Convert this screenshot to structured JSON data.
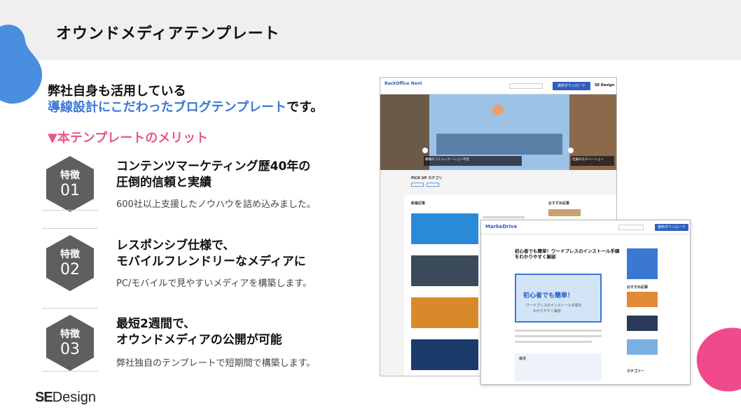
{
  "header": {
    "title": "オウンドメディアテンプレート"
  },
  "lead": {
    "line1": "弊社自身も活用している",
    "line2_highlight": "導線設計にこだわったブログテンプレート",
    "line2_suffix": "です。"
  },
  "merit_heading": "▼本テンプレートのメリット",
  "features": [
    {
      "badge_top": "特徴",
      "badge_num": "01",
      "title_l1": "コンテンツマーケティング歴40年の",
      "title_l2": "圧倒的信頼と実績",
      "desc": "600社以上支援したノウハウを詰め込みました。"
    },
    {
      "badge_top": "特徴",
      "badge_num": "02",
      "title_l1": "レスポンシブ仕様で、",
      "title_l2": "モバイルフレンドリーなメディアに",
      "desc": "PC/モバイルで見やすいメディアを構築します。"
    },
    {
      "badge_top": "特徴",
      "badge_num": "03",
      "title_l1": "最短2週間で、",
      "title_l2": "オウンドメディアの公開が可能",
      "desc": "弊社独自のテンプレートで短期間で構築します。"
    }
  ],
  "logo": {
    "bold": "SE",
    "light": "Design"
  },
  "screenshot1": {
    "site_name": "BackOffice Next",
    "button": "資料ダウンロード",
    "brand": "SE Design",
    "pickup": "PICK UP カテゴリ",
    "new_articles": "新着記事",
    "recommended": "おすすめ記事",
    "hero_caption1": "職場のコミュニケーション不足",
    "hero_caption2": "社員のモチベーション"
  },
  "screenshot2": {
    "site_name": "MarkeDrive",
    "button": "資料ダウンロード",
    "article_title": "初心者でも簡単！ワードプレスのインストール手順をわかりやすく解説",
    "banner_text": "初心者でも簡単！",
    "banner_sub1": "ワードプレスのインストール手順を",
    "banner_sub2": "わかりやすく解説",
    "side_heading": "おすすめ記事",
    "category": "カテゴリー",
    "toc": "目次"
  },
  "colors": {
    "accent_blue": "#3a78d4",
    "accent_pink": "#e8558e",
    "hex_gray": "#5f5f5f",
    "blob_yellow": "#f7b84a",
    "blob_blue": "#4a8ee0"
  }
}
